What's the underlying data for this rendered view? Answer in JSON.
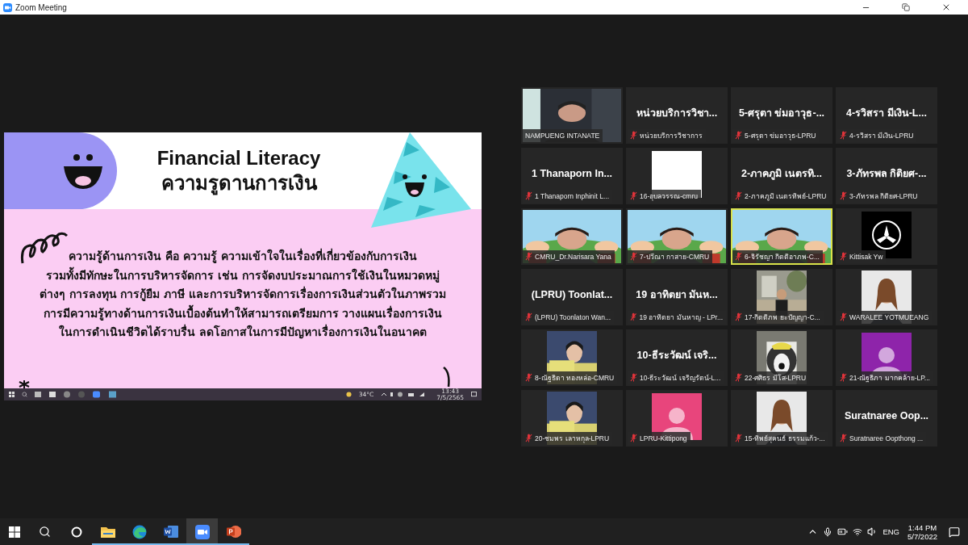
{
  "window": {
    "title": "Zoom Meeting"
  },
  "shared_slide": {
    "title": "Financial Literacy",
    "subtitle": "ความรูดานการเงิน",
    "body_lines": [
      "ความรู้ด้านการเงิน คือ ความรู้ ความเข้าใจในเรื่องที่เกี่ยวข้องกับการเงิน",
      "รวมทั้งมีทักษะในการบริหารจัดการ เช่น การจัดงบประมาณการใช้เงินในหมวดหมู่",
      "ต่างๆ การลงทุน การกู้ยืม ภาษี และการบริหารจัดการเรื่องการเงินส่วนตัวในภาพรวม",
      "การมีความรู้ทางด้านการเงินเบื้องต้นทำให้สามารถเตรียมการ วางแผนเรื่องการเงิน",
      "ในการดำเนินชีวิตได้ราบรื่น ลดโอกาสในการมีปัญหาเรื่องการเงินในอนาคต"
    ],
    "inner_taskbar": {
      "weather": "34°C",
      "time": "13:43",
      "date": "7/5/2565"
    }
  },
  "participants": [
    {
      "kind": "video",
      "label": "NAMPUENG INTANATE",
      "muted": false,
      "speaking": false
    },
    {
      "kind": "name",
      "display": "หน่วยบริการวิชา...",
      "label": "หน่วยบริการวิชาการ",
      "muted": true,
      "speaking": false
    },
    {
      "kind": "name",
      "display": "5-ศรุตา ข่มอาวุธ-...",
      "label": "5-ศรุตา ข่มอาวุธ-LPRU",
      "muted": true,
      "speaking": false
    },
    {
      "kind": "name",
      "display": "4-รวิสรา มีเงิน-L...",
      "label": "4-รวิสรา มีเงิน-LPRU",
      "muted": true,
      "speaking": false
    },
    {
      "kind": "name",
      "display": "1 Thanaporn In...",
      "label": "1 Thanaporn Inphinit L...",
      "muted": true,
      "speaking": false
    },
    {
      "kind": "blank",
      "label": "16-อุบลวรรณ-cmru",
      "muted": true,
      "speaking": false
    },
    {
      "kind": "name",
      "display": "2-ภาคภูมิ เนตรทิ...",
      "label": "2-ภาคภูมิ เนตรทิพย์-LPRU",
      "muted": true,
      "speaking": false
    },
    {
      "kind": "name",
      "display": "3-ภัทรพล กิติยศ-...",
      "label": "3-ภัทรพล กิติยศ-LPRU",
      "muted": true,
      "speaking": false
    },
    {
      "kind": "video",
      "label": "CMRU_Dr.Narisara Yana",
      "muted": true,
      "speaking": false
    },
    {
      "kind": "video",
      "label": "7-ปวีณา กาสาย-CMRU",
      "muted": true,
      "speaking": false
    },
    {
      "kind": "video",
      "label": "6-จิรัชญา กิตติอาภพ-C...",
      "muted": true,
      "speaking": true
    },
    {
      "kind": "logo",
      "label": "Kittisak Yw",
      "muted": true,
      "speaking": false
    },
    {
      "kind": "name",
      "display": "(LPRU)  Toonlat...",
      "label": "(LPRU) Toonlaton Wan...",
      "muted": true,
      "speaking": false
    },
    {
      "kind": "name",
      "display": "19 อาทิตยา มันห...",
      "label": "19 อาทิตยา มันหาญ - LPr...",
      "muted": true,
      "speaking": false
    },
    {
      "label": "17-กิตติภพ ยะปัญญา-C...",
      "muted": true,
      "speaking": false
    },
    {
      "label": "WARALEE YOTMUEANG",
      "muted": true,
      "speaking": false
    },
    {
      "label": "8-ณัฐธิดา ทองหล่อ-CMRU",
      "muted": true,
      "speaking": false
    },
    {
      "kind": "name",
      "display": "10-ธีระวัฒน์ เจริ...",
      "label": "10-ธีระวัฒน์ เจริญรัตน์-L...",
      "muted": true,
      "speaking": false
    },
    {
      "label": "22-ศศิธร มีโส-LPRU",
      "muted": true,
      "speaking": false
    },
    {
      "kind": "avatar",
      "color": "#8e24aa",
      "label": "21-ณัฐธิภา มากคล้าย-LP...",
      "muted": true,
      "speaking": false
    },
    {
      "label": "20-ชมพร เลาหกุล-LPRU",
      "muted": true,
      "speaking": false
    },
    {
      "kind": "avatar",
      "color": "#e8457c",
      "label": "LPRU-Kittipong",
      "muted": true,
      "speaking": false
    },
    {
      "label": "15-ทิพย์สุคนธ์ ธรรมแก้ว-...",
      "muted": true,
      "speaking": false
    },
    {
      "kind": "name",
      "display": "Suratnaree Oop...",
      "label": "Suratnaree Oopthong ...",
      "muted": true,
      "speaking": false
    }
  ],
  "taskbar": {
    "apps": [
      {
        "kind": "explorer",
        "running": true,
        "active": false
      },
      {
        "kind": "edge",
        "running": true,
        "active": false
      },
      {
        "kind": "word",
        "running": true,
        "active": false
      },
      {
        "kind": "zoom",
        "running": true,
        "active": true
      },
      {
        "kind": "powerpoint",
        "running": true,
        "active": false
      }
    ],
    "language": "ENG",
    "time": "1:44 PM",
    "date": "5/7/2022"
  }
}
